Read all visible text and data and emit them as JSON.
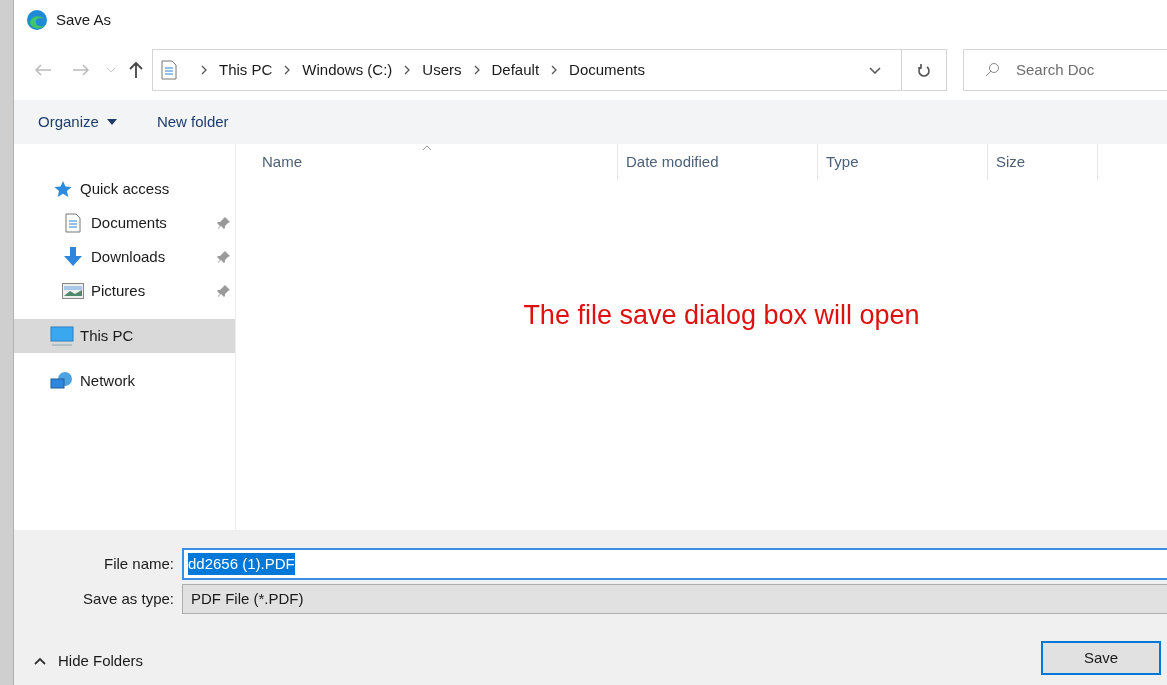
{
  "window": {
    "title": "Save As"
  },
  "breadcrumb": [
    "This PC",
    "Windows (C:)",
    "Users",
    "Default",
    "Documents"
  ],
  "search": {
    "placeholder": "Search Doc"
  },
  "toolbar": {
    "organize": "Organize",
    "new_folder": "New folder"
  },
  "columns": [
    {
      "label": "Name",
      "sorted": true
    },
    {
      "label": "Date modified",
      "sorted": false
    },
    {
      "label": "Type",
      "sorted": false
    },
    {
      "label": "Size",
      "sorted": false
    }
  ],
  "sidebar": {
    "items": [
      {
        "label": "Quick access",
        "selected": false,
        "children": [
          {
            "label": "Documents",
            "selected": false,
            "pinned": true
          },
          {
            "label": "Downloads",
            "selected": false,
            "pinned": true
          },
          {
            "label": "Pictures",
            "selected": false,
            "pinned": true
          }
        ]
      },
      {
        "label": "This PC",
        "selected": true
      },
      {
        "label": "Network",
        "selected": false
      }
    ]
  },
  "annotation": "The file save dialog box will open",
  "file_name": {
    "label": "File name:",
    "value": "dd2656 (1).PDF",
    "selected": true
  },
  "save_type": {
    "label": "Save as type:",
    "value": "PDF File (*.PDF)"
  },
  "hide_folders": "Hide Folders",
  "buttons": [
    "Save"
  ]
}
